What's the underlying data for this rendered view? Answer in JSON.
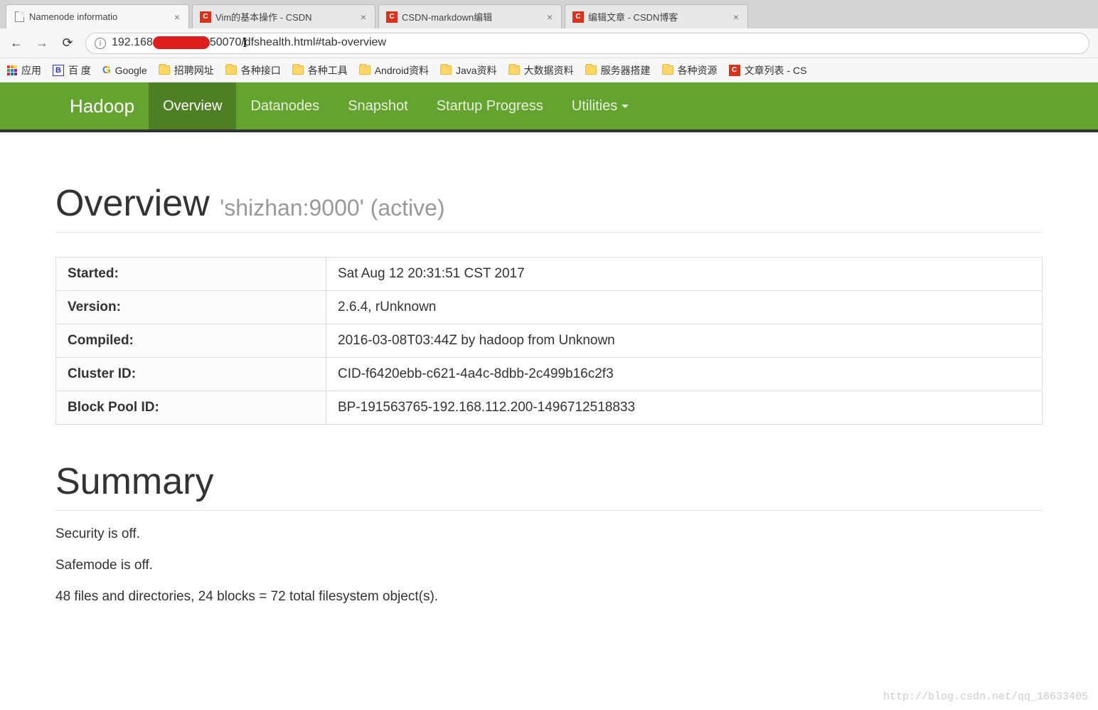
{
  "browser": {
    "tabs": [
      {
        "title": "Namenode informatio",
        "type": "page"
      },
      {
        "title": "Vim的基本操作 - CSDN",
        "type": "csdn"
      },
      {
        "title": "CSDN-markdown编辑",
        "type": "csdn"
      },
      {
        "title": "编辑文章 - CSDN博客",
        "type": "csdn"
      }
    ],
    "url_prefix": "192.168",
    "url_suffix": "50070/dfshealth.html#tab-overview"
  },
  "bookmarks": {
    "apps": "应用",
    "items": [
      {
        "icon": "baidu",
        "label": "百 度"
      },
      {
        "icon": "google",
        "label": "Google"
      },
      {
        "icon": "folder",
        "label": "招聘网址"
      },
      {
        "icon": "folder",
        "label": "各种接口"
      },
      {
        "icon": "folder",
        "label": "各种工具"
      },
      {
        "icon": "folder",
        "label": "Android资料"
      },
      {
        "icon": "folder",
        "label": "Java资料"
      },
      {
        "icon": "folder",
        "label": "大数据资料"
      },
      {
        "icon": "folder",
        "label": "服务器搭建"
      },
      {
        "icon": "folder",
        "label": "各种资源"
      },
      {
        "icon": "csdn",
        "label": "文章列表 - CS"
      }
    ]
  },
  "nav": {
    "brand": "Hadoop",
    "items": [
      "Overview",
      "Datanodes",
      "Snapshot",
      "Startup Progress",
      "Utilities"
    ]
  },
  "overview": {
    "heading": "Overview",
    "subheading": "'shizhan:9000' (active)",
    "rows": [
      {
        "label": "Started:",
        "value": "Sat Aug 12 20:31:51 CST 2017"
      },
      {
        "label": "Version:",
        "value": "2.6.4, rUnknown"
      },
      {
        "label": "Compiled:",
        "value": "2016-03-08T03:44Z by hadoop from Unknown"
      },
      {
        "label": "Cluster ID:",
        "value": "CID-f6420ebb-c621-4a4c-8dbb-2c499b16c2f3"
      },
      {
        "label": "Block Pool ID:",
        "value": "BP-191563765-192.168.112.200-1496712518833"
      }
    ]
  },
  "summary": {
    "heading": "Summary",
    "lines": [
      "Security is off.",
      "Safemode is off.",
      "48 files and directories, 24 blocks = 72 total filesystem object(s)."
    ]
  },
  "watermark": "http://blog.csdn.net/qq_16633405"
}
